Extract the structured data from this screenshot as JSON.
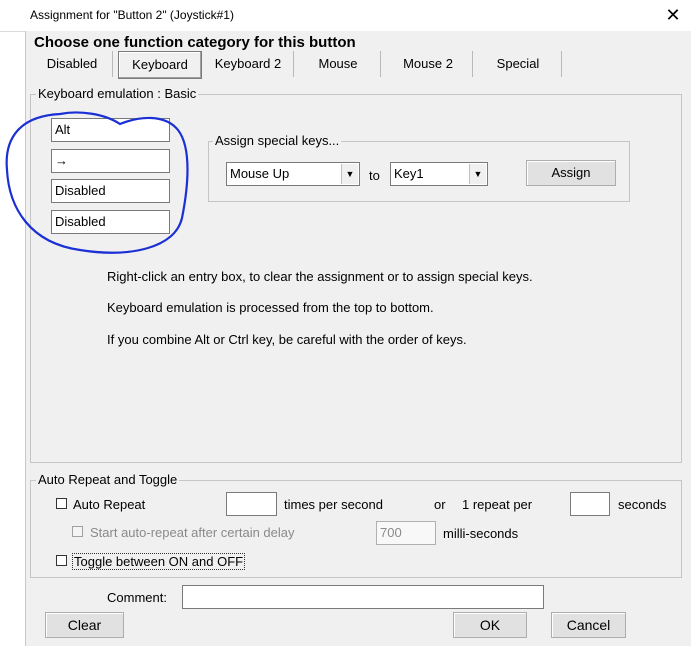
{
  "window": {
    "title": "Assignment for \"Button 2\" (Joystick#1)",
    "close_glyph": "✕"
  },
  "heading": "Choose one function category for this button",
  "tabs": [
    {
      "label": "Disabled"
    },
    {
      "label": "Keyboard",
      "active": true
    },
    {
      "label": "Keyboard 2"
    },
    {
      "label": "Mouse"
    },
    {
      "label": "Mouse 2"
    },
    {
      "label": "Special"
    }
  ],
  "keyboard_group": {
    "legend": "Keyboard emulation : Basic",
    "entries": [
      "Alt",
      "→",
      "Disabled",
      "Disabled"
    ],
    "special_keys": {
      "legend": "Assign special keys...",
      "from_value": "Mouse Up",
      "to_label": "to",
      "to_value": "Key1",
      "assign_label": "Assign"
    },
    "notes": [
      "Right-click an entry box, to clear the assignment or to assign special keys.",
      "Keyboard emulation is processed from the top to bottom.",
      "If you combine Alt or Ctrl key, be careful with the order of keys."
    ]
  },
  "repeat_group": {
    "legend": "Auto Repeat and Toggle",
    "auto_repeat_label": "Auto Repeat",
    "times_value": "",
    "times_label": "times per second",
    "or_label": "or",
    "one_repeat_label": "1 repeat per",
    "seconds_value": "",
    "seconds_label": "seconds",
    "delay_label": "Start auto-repeat after certain delay",
    "delay_value": "700",
    "milli_label": "milli-seconds",
    "toggle_label": "Toggle between ON and OFF"
  },
  "comment": {
    "label": "Comment:",
    "value": ""
  },
  "buttons": {
    "clear": "Clear",
    "ok": "OK",
    "cancel": "Cancel"
  },
  "annotation": {
    "color": "#1a2fd4"
  }
}
